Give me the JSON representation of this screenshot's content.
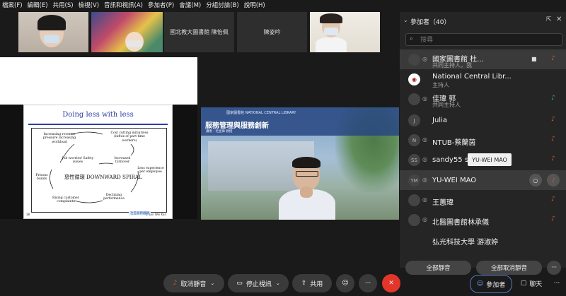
{
  "menu": [
    "檔案(F)",
    "編輯(E)",
    "共用(S)",
    "檢視(V)",
    "音訊和視訊(A)",
    "參加者(P)",
    "會議(M)",
    "分組討論(B)",
    "說明(H)"
  ],
  "thumbnails": [
    {
      "label": ""
    },
    {
      "label": ""
    },
    {
      "label": "國北教大圖書館 陳怡佩"
    },
    {
      "label": "陳姿吟"
    },
    {
      "label": ""
    }
  ],
  "slide": {
    "title": "Doing less with less",
    "nodes": [
      "Increasing revenue pressure increasing workload",
      "Cost cutting initiatives (influx of part time workers)",
      "Job worries/ Safety issues",
      "Increased turnover",
      "Less experience per employee",
      "Prisons builds",
      "Rising customer complaints",
      "Declining performance"
    ],
    "center": "惡性循環 DOWNWARD SPIRAL",
    "logo": "社區服務顧問",
    "footer": "© Lon Wei Kan",
    "page": "38"
  },
  "speaker": {
    "banner_title": "服務管理與服務創新",
    "banner_sub": "國家圖書館 NATIONAL CENTRAL LIBRARY",
    "banner_by": "講者｜毛昱偉 教授"
  },
  "panel": {
    "title": "參加者（40）",
    "search_placeholder": "搜尋",
    "participants": [
      {
        "name": "國家圖書館 杜...",
        "role": "共同主持人，我",
        "avatar": "",
        "mic": "muted",
        "cam": "on"
      },
      {
        "name": "National Central Libr...",
        "role": "主持人",
        "avatar": "logo",
        "mic": "",
        "cam": ""
      },
      {
        "name": "佳瑋 郭",
        "role": "共同主持人",
        "avatar": "",
        "mic": "on",
        "cam": ""
      },
      {
        "name": "Julia",
        "role": "",
        "avatar": "J",
        "mic": "muted",
        "cam": ""
      },
      {
        "name": "NTUB-蔡蘭茵",
        "role": "",
        "avatar": "N",
        "mic": "muted",
        "cam": ""
      },
      {
        "name": "sandy55 sa",
        "role": "",
        "avatar": "SS",
        "mic": "muted",
        "cam": ""
      },
      {
        "name": "YU-WEI MAO",
        "role": "",
        "avatar": "YM",
        "mic": "muted",
        "cam": ""
      },
      {
        "name": "王蕙瑋",
        "role": "",
        "avatar": "",
        "mic": "muted",
        "cam": ""
      },
      {
        "name": "北醫圖書館林承儀",
        "role": "",
        "avatar": "",
        "mic": "muted",
        "cam": ""
      },
      {
        "name": "弘光科技大學 游淑婷",
        "role": "",
        "avatar": "",
        "mic": "",
        "cam": ""
      }
    ],
    "tooltip": "YU-WEI MAO",
    "mute_all": "全部靜音",
    "unmute_all": "全部取消靜音",
    "more": "···"
  },
  "toolbar": {
    "unmute": "取消靜音",
    "stop_video": "停止視訊",
    "share": "共用",
    "reactions": "☺",
    "more": "···",
    "leave": "✕",
    "participants_tab": "參加者",
    "chat_tab": "聊天"
  }
}
